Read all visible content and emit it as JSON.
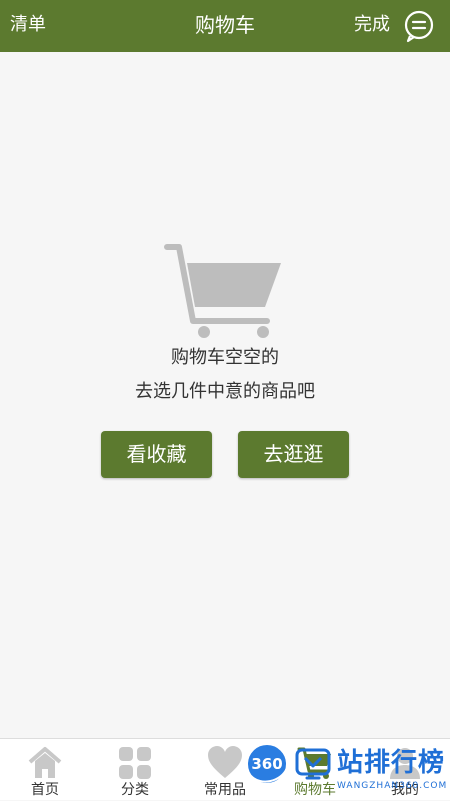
{
  "header": {
    "left_label": "清单",
    "title": "购物车",
    "done_label": "完成",
    "message_icon": "message-icon",
    "color": "#5c7a2f"
  },
  "empty": {
    "illustration_icon": "empty-cart-icon",
    "title": "购物车空空的",
    "subtitle": "去选几件中意的商品吧",
    "buttons": {
      "favorites_label": "看收藏",
      "shop_label": "去逛逛"
    }
  },
  "bottom_nav": {
    "items": [
      {
        "label": "首页",
        "icon": "home-icon"
      },
      {
        "label": "分类",
        "icon": "category-icon"
      },
      {
        "label": "常用品",
        "icon": "heart-icon"
      },
      {
        "label": "购物车",
        "icon": "cart-icon"
      },
      {
        "label": "我的",
        "icon": "user-icon"
      }
    ],
    "active_index": 3,
    "active_color": "#5c7a2f"
  },
  "watermark": {
    "badge_text": "360",
    "text": "站排行榜",
    "subtext": "WANGZHAN360.COM"
  }
}
